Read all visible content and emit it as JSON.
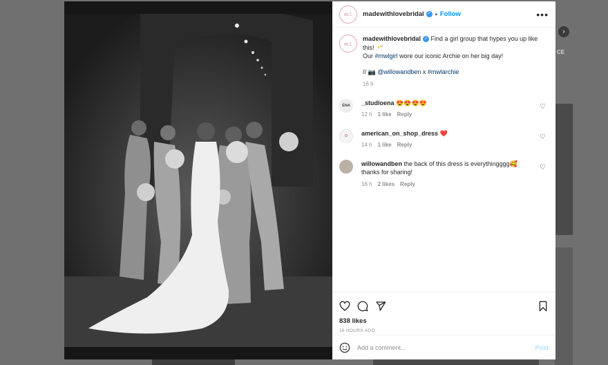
{
  "background": {
    "side_text": "CE",
    "arrow_glyph": "›"
  },
  "post": {
    "username": "madewithlovebridal",
    "avatar_text": "m.l.",
    "verified": true,
    "separator": "•",
    "follow_label": "Follow",
    "more_glyph": "•••",
    "caption": {
      "text_line1": "Find a girl group that hypes you up like this! 🥂",
      "text_line2_pre": "Our ",
      "hashtag1": "#mwlgirl",
      "text_line2_post": " wore our iconic Archie on her big day!",
      "credit_pre": "// 📷 ",
      "mention": "@willowandben",
      "credit_mid": " x ",
      "hashtag2": "#mwlarchie",
      "time": "16 h"
    },
    "comments": [
      {
        "username": "_studioena",
        "avatar_text": "ÈNA",
        "text": "😍😍😍😍",
        "time": "12 h",
        "likes": "1 like",
        "reply": "Reply"
      },
      {
        "username": "american_on_shop_dress",
        "avatar_text": "✿",
        "text": "❤️",
        "time": "14 h",
        "likes": "1 like",
        "reply": "Reply"
      },
      {
        "username": "willowandben",
        "avatar_text": "",
        "text": "the back of this dress is everythingggg🥰 thanks for sharing!",
        "time": "16 h",
        "likes": "2 likes",
        "reply": "Reply"
      }
    ],
    "likes": "838 likes",
    "posted_ago": "16 HOURS AGO",
    "comment_placeholder": "Add a comment...",
    "post_label": "Post"
  },
  "colors": {
    "accent": "#0095f6",
    "post_disabled": "#b2dffc",
    "verified": "#3897f0",
    "hashtag": "#00376b",
    "muted": "#8e8e8e"
  }
}
